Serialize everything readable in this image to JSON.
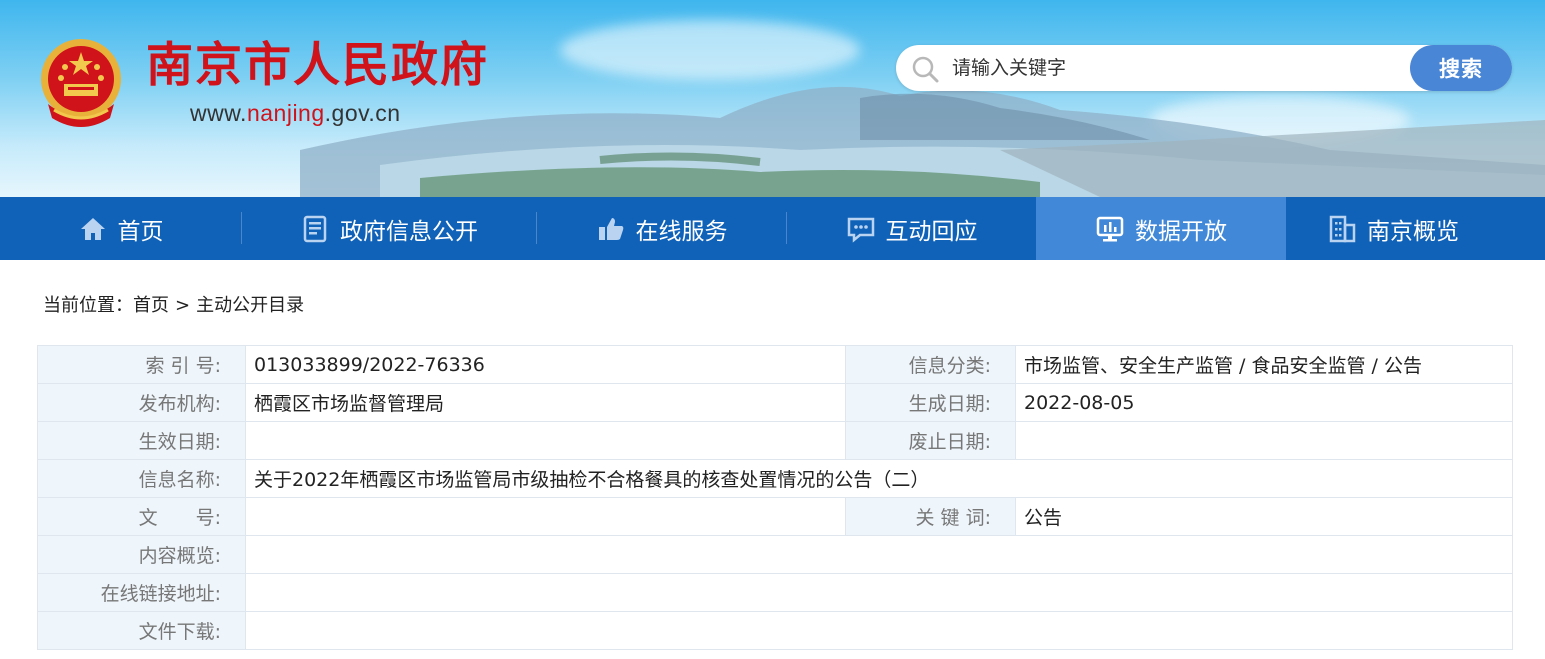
{
  "header": {
    "site_title": "南京市人民政府",
    "site_url_prefix": "www.",
    "site_url_highlight": "nanjing",
    "site_url_suffix": ".gov.cn",
    "search_placeholder": "请输入关键字",
    "search_button": "搜索"
  },
  "nav": {
    "items": [
      {
        "label": "首页",
        "icon": "home-icon"
      },
      {
        "label": "政府信息公开",
        "icon": "document-icon"
      },
      {
        "label": "在线服务",
        "icon": "thumbs-up-icon"
      },
      {
        "label": "互动回应",
        "icon": "chat-icon"
      },
      {
        "label": "数据开放",
        "icon": "data-chart-icon",
        "active": true
      },
      {
        "label": "南京概览",
        "icon": "building-icon"
      }
    ]
  },
  "breadcrumb": {
    "prefix": "当前位置：",
    "home": "首页",
    "separator": ">",
    "current": "主动公开目录"
  },
  "info": {
    "index_no_label": "索 引 号:",
    "index_no": "013033899/2022-76336",
    "category_label": "信息分类:",
    "category": "市场监管、安全生产监管 / 食品安全监管 / 公告",
    "publisher_label": "发布机构:",
    "publisher": "栖霞区市场监督管理局",
    "created_label": "生成日期:",
    "created": "2022-08-05",
    "effective_label": "生效日期:",
    "effective": "",
    "expired_label": "废止日期:",
    "expired": "",
    "name_label": "信息名称:",
    "name": "关于2022年栖霞区市场监管局市级抽检不合格餐具的核查处置情况的公告（二）",
    "doc_no_label": "文　　号:",
    "doc_no": "",
    "keywords_label": "关 键 词:",
    "keywords": "公告",
    "summary_label": "内容概览:",
    "summary": "",
    "link_label": "在线链接地址:",
    "link": "",
    "download_label": "文件下载:",
    "download": ""
  },
  "colors": {
    "title_red": "#d0121b",
    "nav_blue": "#1062b8",
    "nav_active": "#4189d8",
    "search_button": "#4a86d6",
    "label_bg": "#eef5fb"
  }
}
